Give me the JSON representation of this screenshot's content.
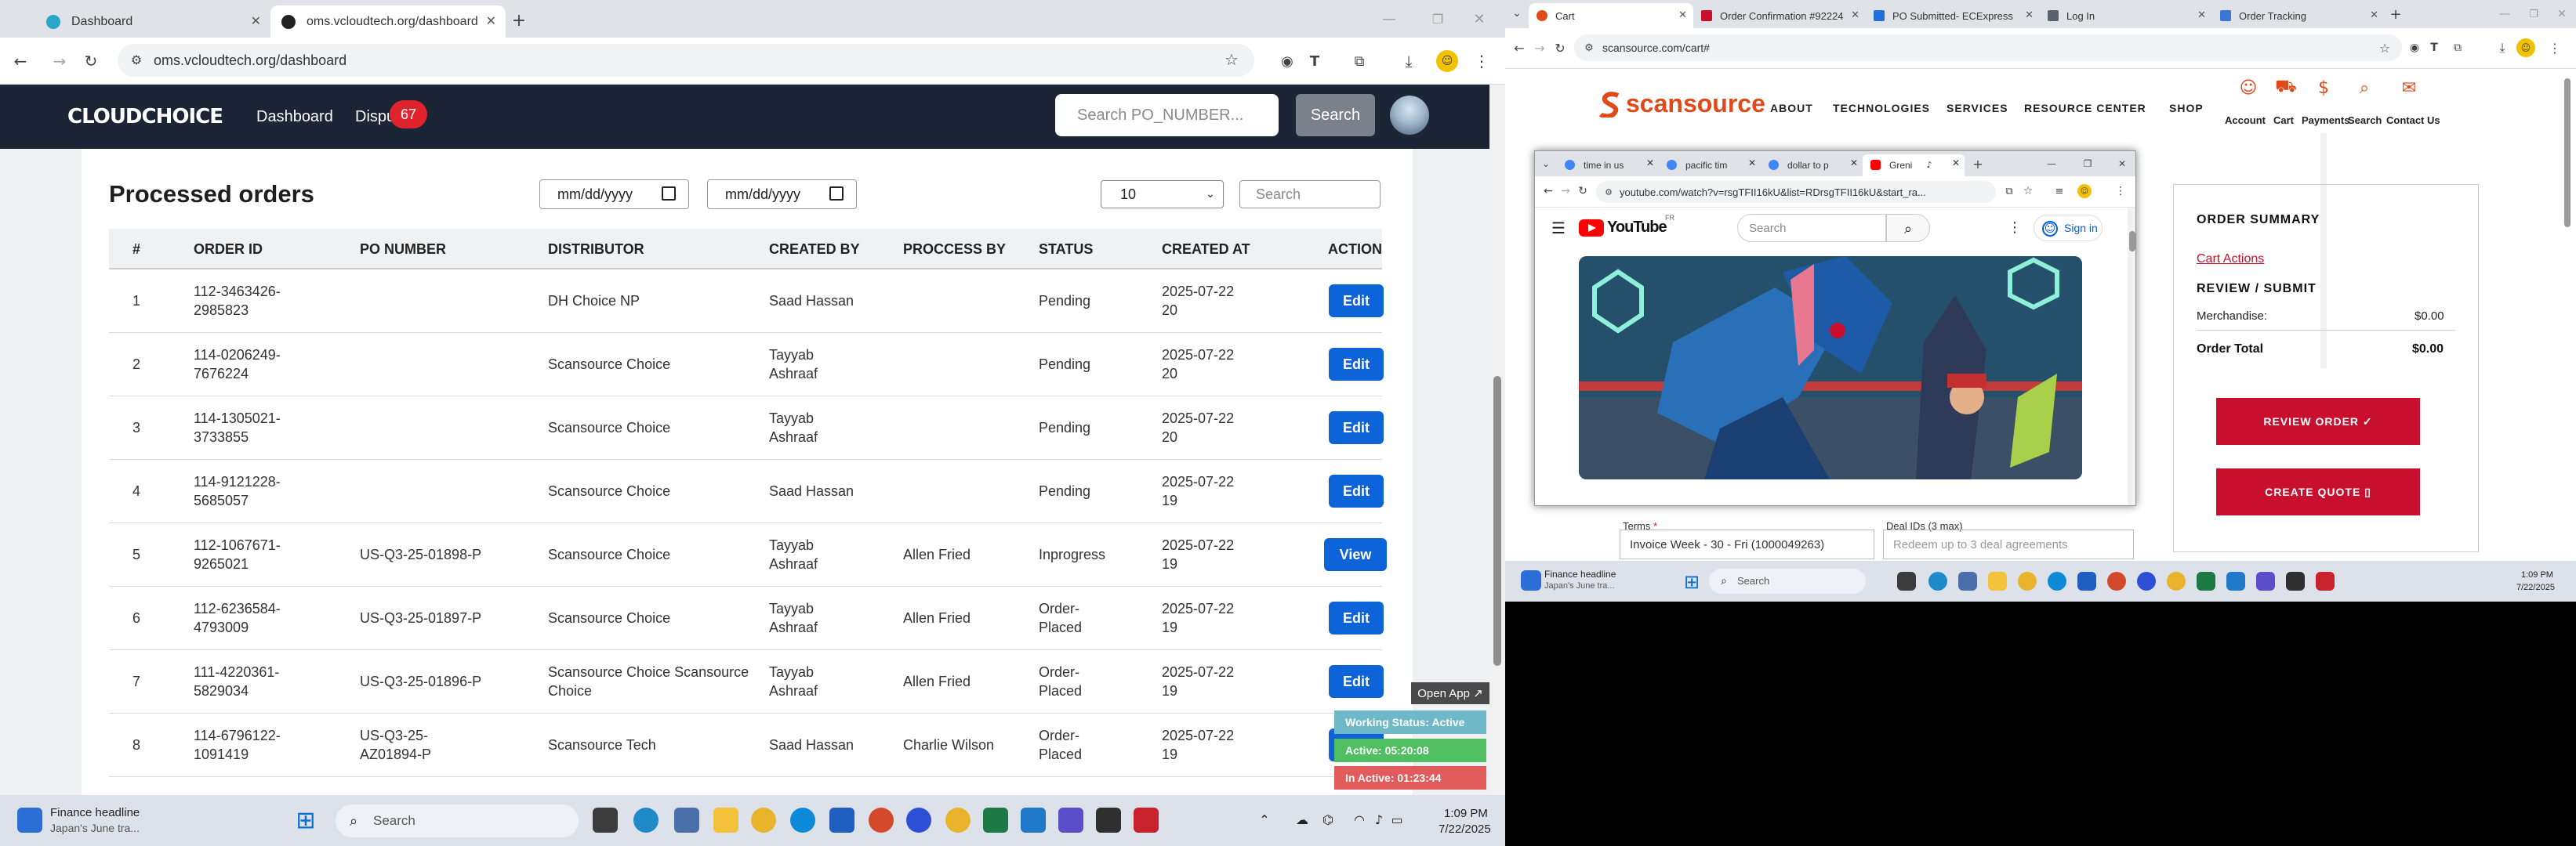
{
  "left_browser": {
    "tabs": [
      {
        "label": "Dashboard"
      },
      {
        "label": "oms.vcloudtech.org/dashboard"
      }
    ],
    "url": "oms.vcloudtech.org/dashboard",
    "app": {
      "logo": "CLOUDCHOICE",
      "nav": [
        "Dashboard",
        "Dispu"
      ],
      "disputes_badge": "67",
      "search_placeholder": "Search PO_NUMBER...",
      "search_button": "Search"
    },
    "panel": {
      "title": "Processed orders",
      "date_from": "mm/dd/yyyy",
      "date_to": "mm/dd/yyyy",
      "page_size": "10",
      "search_placeholder": "Search",
      "headers": [
        "#",
        "ORDER ID",
        "PO NUMBER",
        "DISTRIBUTOR",
        "CREATED BY",
        "PROCCESS BY",
        "STATUS",
        "CREATED AT",
        "ACTION"
      ],
      "rows": [
        {
          "num": "1",
          "order_id": "112-3463426-\n2985823",
          "po": "",
          "distributor": "DH Choice NP",
          "created_by": "Saad Hassan",
          "process_by": "",
          "status": "Pending",
          "created_at": "2025-07-22\n20",
          "action": "Edit"
        },
        {
          "num": "2",
          "order_id": "114-0206249-\n7676224",
          "po": "",
          "distributor": "Scansource Choice",
          "created_by": "Tayyab\nAshraaf",
          "process_by": "",
          "status": "Pending",
          "created_at": "2025-07-22\n20",
          "action": "Edit"
        },
        {
          "num": "3",
          "order_id": "114-1305021-\n3733855",
          "po": "",
          "distributor": "Scansource Choice",
          "created_by": "Tayyab\nAshraaf",
          "process_by": "",
          "status": "Pending",
          "created_at": "2025-07-22\n20",
          "action": "Edit"
        },
        {
          "num": "4",
          "order_id": "114-9121228-\n5685057",
          "po": "",
          "distributor": "Scansource Choice",
          "created_by": "Saad Hassan",
          "process_by": "",
          "status": "Pending",
          "created_at": "2025-07-22\n19",
          "action": "Edit"
        },
        {
          "num": "5",
          "order_id": "112-1067671-\n9265021",
          "po": "US-Q3-25-01898-P",
          "distributor": "Scansource Choice",
          "created_by": "Tayyab\nAshraaf",
          "process_by": "Allen Fried",
          "status": "Inprogress",
          "created_at": "2025-07-22\n19",
          "action": "View"
        },
        {
          "num": "6",
          "order_id": "112-6236584-\n4793009",
          "po": "US-Q3-25-01897-P",
          "distributor": "Scansource Choice",
          "created_by": "Tayyab\nAshraaf",
          "process_by": "Allen Fried",
          "status": "Order-\nPlaced",
          "created_at": "2025-07-22\n19",
          "action": "Edit"
        },
        {
          "num": "7",
          "order_id": "111-4220361-\n5829034",
          "po": "US-Q3-25-01896-P",
          "distributor": "Scansource Choice Scansource\nChoice",
          "created_by": "Tayyab\nAshraaf",
          "process_by": "Allen Fried",
          "status": "Order-\nPlaced",
          "created_at": "2025-07-22\n19",
          "action": "Edit"
        },
        {
          "num": "8",
          "order_id": "114-6796122-\n1091419",
          "po": "US-Q3-25-\nAZ01894-P",
          "distributor": "Scansource Tech",
          "created_by": "Saad Hassan",
          "process_by": "Charlie Wilson",
          "status": "Order-\nPlaced",
          "created_at": "2025-07-22\n19",
          "action": "Edit"
        }
      ]
    },
    "widget": {
      "open_app": "Open App ↗",
      "working_status": "Working Status: Active",
      "active": "Active: 05:20:08",
      "inactive": "In Active: 01:23:44"
    },
    "taskbar": {
      "news_title": "Finance headline",
      "news_sub": "Japan's June tra...",
      "search": "Search",
      "time": "1:09 PM",
      "date": "7/22/2025"
    }
  },
  "right_browser": {
    "tabs": [
      {
        "label": "Cart"
      },
      {
        "label": "Order Confirmation #92224"
      },
      {
        "label": "PO Submitted- ECExpress"
      },
      {
        "label": "Log In"
      },
      {
        "label": "Order Tracking"
      }
    ],
    "url": "scansource.com/cart#",
    "logo": "scansource",
    "nav": [
      "ABOUT",
      "TECHNOLOGIES",
      "SERVICES",
      "RESOURCE CENTER",
      "SHOP"
    ],
    "icons": [
      "Account",
      "Cart",
      "Payments",
      "Search",
      "Contact Us"
    ],
    "summary": {
      "title": "ORDER SUMMARY",
      "cart_actions": "Cart Actions",
      "review_title": "REVIEW / SUBMIT",
      "merch_label": "Merchandise:",
      "merch_value": "$0.00",
      "total_label": "Order Total",
      "total_value": "$0.00",
      "review_button": "REVIEW ORDER ✓",
      "quote_button": "CREATE QUOTE ▯"
    },
    "terms_label": "Terms",
    "terms_value": "Invoice Week - 30 - Fri (1000049263)",
    "deal_label": "Deal IDs (3 max)",
    "deal_placeholder": "Redeem up to 3 deal agreements",
    "taskbar": {
      "news_title": "Finance headline",
      "news_sub": "Japan's June tra...",
      "search": "Search",
      "time": "1:09 PM",
      "date": "7/22/2025"
    }
  },
  "youtube": {
    "tabs": [
      "time in us",
      "pacific tim",
      "dollar to p",
      "Greni"
    ],
    "url": "youtube.com/watch?v=rsgTFII16kU&list=RDrsgTFII16kU&start_ra...",
    "logo": "YouTube",
    "region": "FR",
    "search_placeholder": "Search",
    "signin": "Sign in"
  },
  "colors": {
    "header": "#1b2535",
    "edit_button": "#0d63d8",
    "badge": "#e0242e",
    "scansource_red": "#c8102e",
    "active_green": "#4fbf61",
    "inactive_red": "#e05b59",
    "status_teal": "#6fb8c8"
  }
}
